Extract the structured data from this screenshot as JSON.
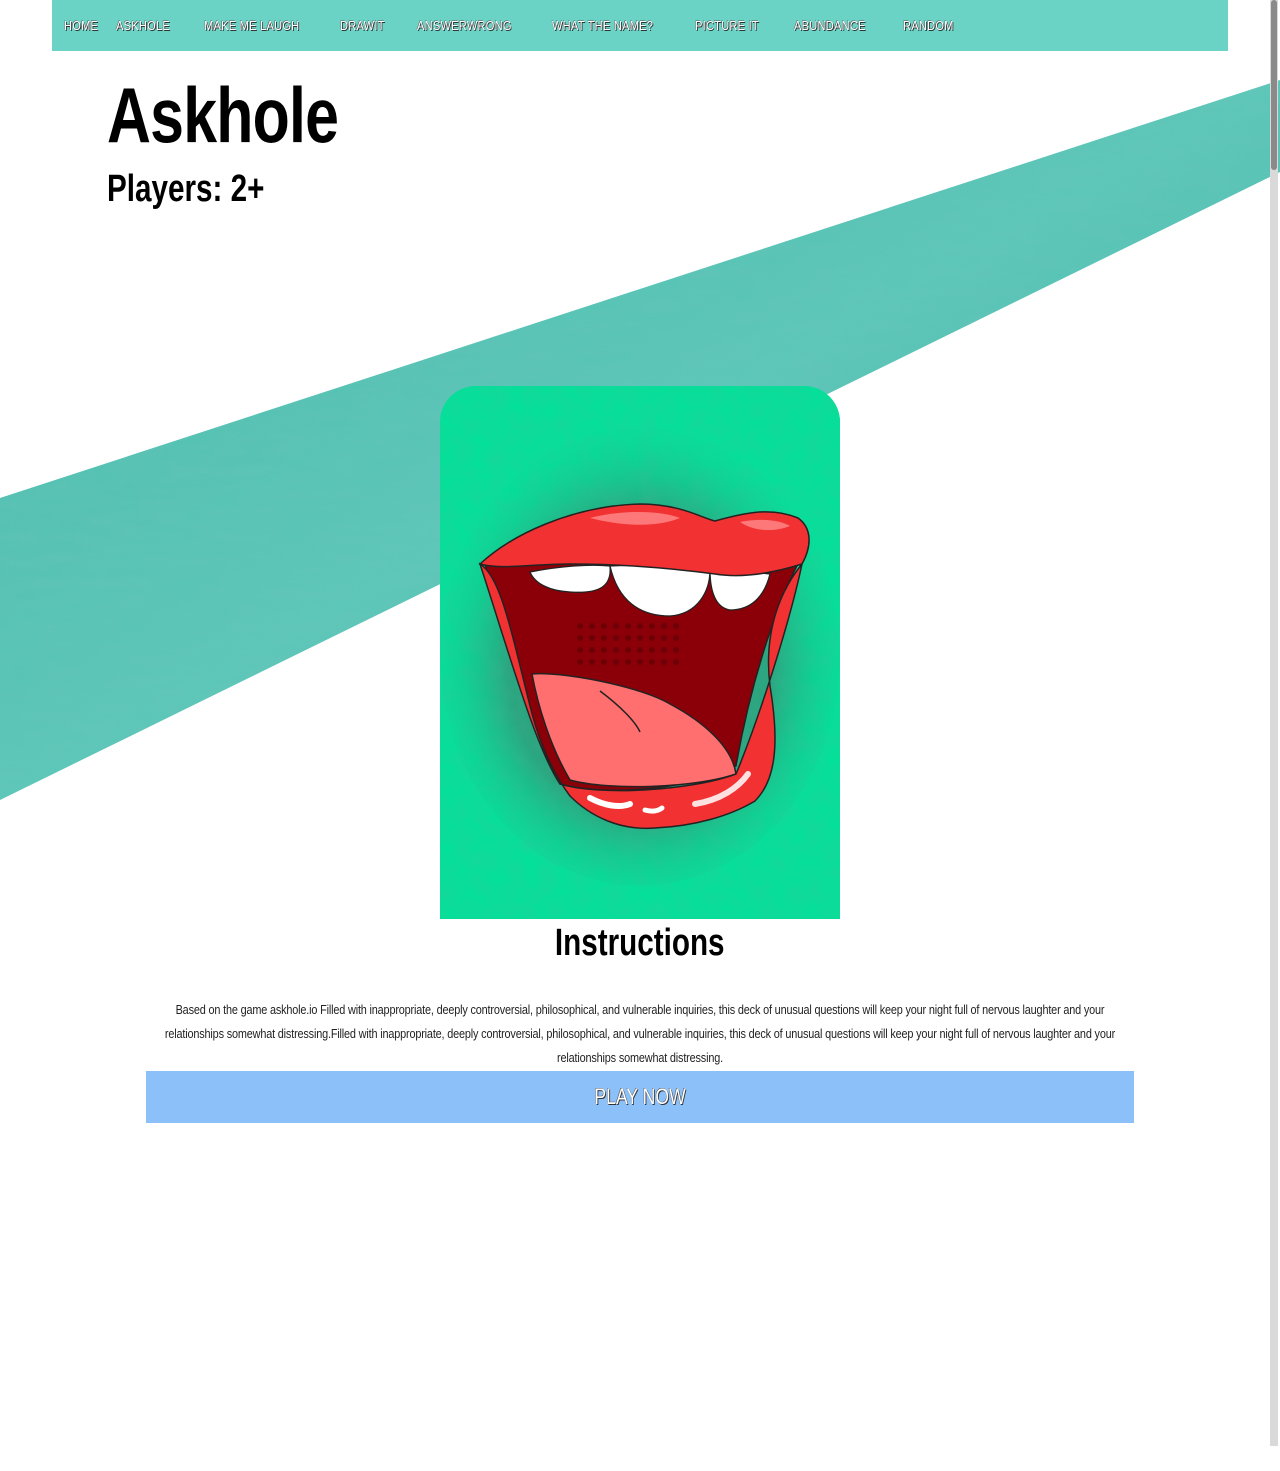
{
  "nav": {
    "items": [
      "HOME",
      "ASKHOLE",
      "MAKE ME LAUGH",
      "DRAWIT",
      "ANSWERWRONG",
      "WHAT THE NAME?",
      "PICTURE IT",
      "ABUNDANCE",
      "RANDOM"
    ]
  },
  "game": {
    "title": "Askhole",
    "players": "Players: 2+",
    "card_image_icon": "open-mouth-lips-icon"
  },
  "instructions": {
    "heading": "Instructions",
    "text": "Based on the game askhole.io Filled with inappropriate, deeply controversial, philosophical, and vulnerable inquiries, this deck of unusual questions will keep your night full of nervous laughter and your relationships somewhat distressing.Filled with inappropriate, deeply controversial, philosophical, and vulnerable inquiries, this deck of unusual questions will keep your night full of nervous laughter and your relationships somewhat distressing."
  },
  "cta": {
    "play_label": "PLAY NOW"
  },
  "colors": {
    "nav_bg": "#6ad3c6",
    "stripe": "#3fb3a5",
    "card_bg": "#00e299",
    "button_bg": "#8bc0f8"
  }
}
